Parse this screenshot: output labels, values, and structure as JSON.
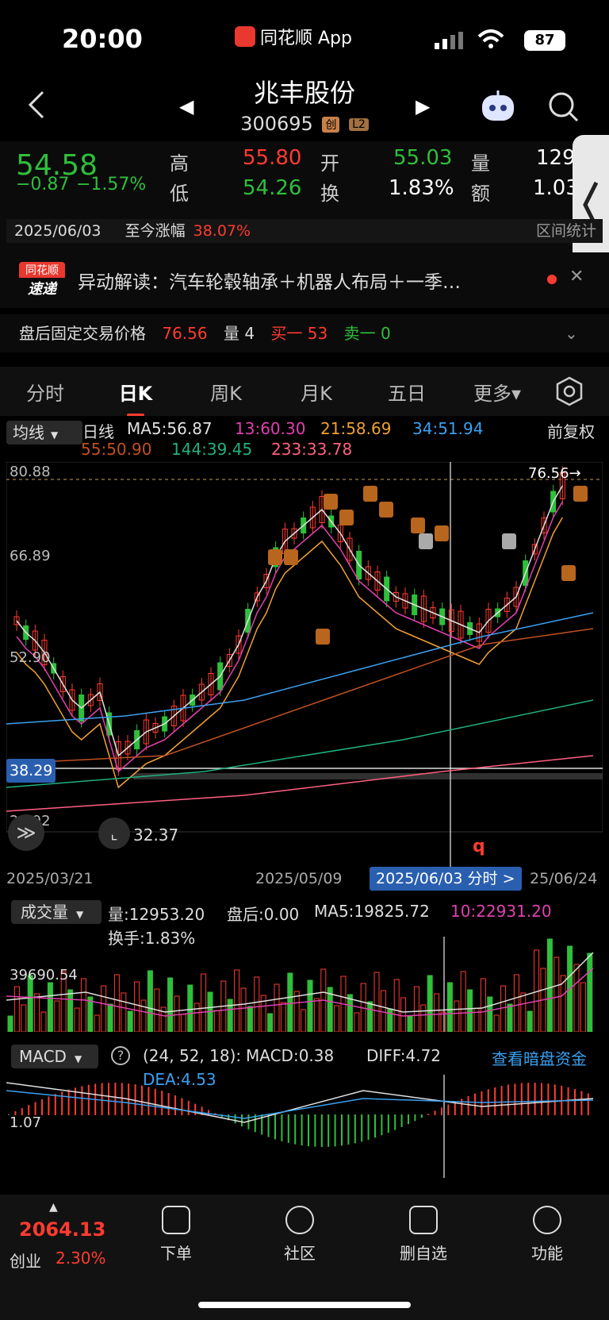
{
  "status": {
    "time": "20:00",
    "app": "同花顺 App",
    "battery": "87"
  },
  "header": {
    "title": "兆丰股份",
    "code": "300695",
    "tag1": "创",
    "tag2": "L2"
  },
  "quote": {
    "price": "54.58",
    "change": "−0.87",
    "change_pct": "−1.57%",
    "high_label": "高",
    "high": "55.80",
    "low_label": "低",
    "low": "54.26",
    "open_label": "开",
    "open": "55.03",
    "turnover_label": "换",
    "turnover": "1.83%",
    "vol_label": "量",
    "vol": "129",
    "amt_label": "额",
    "amt": "1.03"
  },
  "date_row": {
    "date": "2025/06/03",
    "since_label": "至今涨幅",
    "since": "38.07%",
    "stats": "区间统计"
  },
  "news": {
    "badge1": "同花顺",
    "badge2": "速递",
    "text": "异动解读：汽车轮毂轴承＋机器人布局＋一季…"
  },
  "after_hours": {
    "label": "盘后固定交易价格",
    "price": "76.56",
    "vol": "量 4",
    "buy": "买一 53",
    "sell": "卖一 0"
  },
  "tabs": [
    "分时",
    "日K",
    "周K",
    "月K",
    "五日",
    "更多▾"
  ],
  "ma": {
    "selector": "均线",
    "line": "日线",
    "fuquan": "前复权",
    "ma5": "MA5:56.87",
    "ma13": "13:60.30",
    "ma21": "21:58.69",
    "ma34": "34:51.94",
    "ma55": "55:50.90",
    "ma144": "144:39.45",
    "ma233": "233:33.78"
  },
  "chart": {
    "y_top": "80.88",
    "y_mid": "66.89",
    "y_low": "52.90",
    "y_bottom": "24.92",
    "price_line": "38.29",
    "low_mark": "32.37",
    "close_mark": "76.56→",
    "x_start": "2025/03/21",
    "x_mid": "2025/05/09",
    "x_sel": "2025/06/03 分时 >",
    "x_end": "25/06/24"
  },
  "volume": {
    "label": "成交量",
    "vol": "量:12953.20",
    "after": "盘后:0.00",
    "ma5": "MA5:19825.72",
    "ma10": "10:22931.20",
    "turnover": "换手:1.83%",
    "axis": "39690.54"
  },
  "macd": {
    "label": "MACD",
    "params": "(24, 52, 18):",
    "macd": "MACD:0.38",
    "diff": "DIFF:4.72",
    "dea": "DEA:4.53",
    "link": "查看暗盘资金",
    "axis": "1.07"
  },
  "bottom": {
    "index": "2064.13",
    "index_name": "创业",
    "index_pct": "2.30%",
    "b1": "下单",
    "b2": "社区",
    "b3": "删自选",
    "b4": "功能"
  },
  "colors": {
    "red": "#ff3b30",
    "green": "#2fbf3b",
    "orange": "#f0a030",
    "blue": "#3aa0f0",
    "magenta": "#e040b0",
    "white_line": "#e0e0e0"
  }
}
